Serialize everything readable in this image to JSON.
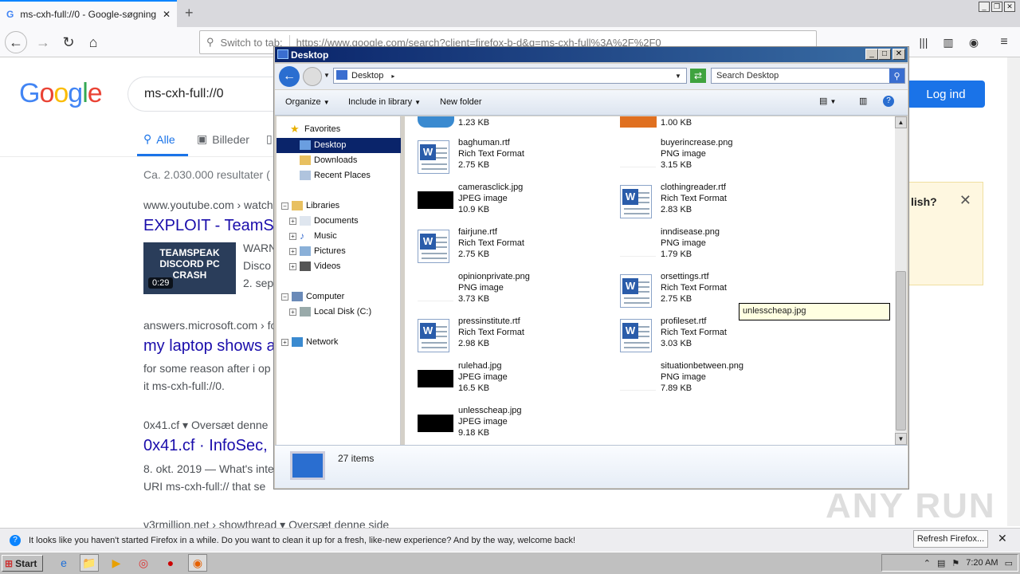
{
  "browser": {
    "tab_title": "ms-cxh-full://0 - Google-søgning",
    "url_placeholder": "Switch to tab:",
    "url": "https://www.google.com/search?client=firefox-b-d&q=ms-cxh-full%3A%2F%2F0"
  },
  "google": {
    "logo": "Google",
    "query": "ms-cxh-full://0",
    "login_label": "Log ind",
    "tabs": [
      {
        "label": "Alle"
      },
      {
        "label": "Billeder"
      }
    ],
    "results_count": "Ca. 2.030.000 resultater (",
    "popup_text": "lish?",
    "results": [
      {
        "cite": "www.youtube.com › watch",
        "title": "EXPLOIT - TeamS",
        "snippet1": "WARN",
        "snippet2": "Disco",
        "date": "2. sep",
        "thumb_text": "TEAMSPEAK DISCORD PC CRASH",
        "duration": "0:29"
      },
      {
        "cite": "answers.microsoft.com › fo",
        "title": "my laptop shows a",
        "snippet1": "for some reason after i op",
        "snippet2": "it ms-cxh-full://0."
      },
      {
        "cite": "0x41.cf ▾ Oversæt denne",
        "title": "0x41.cf · InfoSec, ",
        "snippet1": "8. okt. 2019 — What's inte",
        "snippet2": "URI ms-cxh-full:// that se"
      },
      {
        "cite": "v3rmillion.net › showthread ▾ Oversæt denne side"
      }
    ]
  },
  "notification": {
    "text": "It looks like you haven't started Firefox in a while. Do you want to clean it up for a fresh, like-new experience? And by the way, welcome back!",
    "button": "Refresh Firefox..."
  },
  "watermark": "ANY RUN",
  "explorer": {
    "title": "Desktop",
    "address": "Desktop",
    "search_placeholder": "Search Desktop",
    "toolbar": {
      "organize": "Organize",
      "include": "Include in library",
      "new_folder": "New folder"
    },
    "nav": {
      "favorites": "Favorites",
      "desktop": "Desktop",
      "downloads": "Downloads",
      "recent": "Recent Places",
      "libraries": "Libraries",
      "documents": "Documents",
      "music": "Music",
      "pictures": "Pictures",
      "videos": "Videos",
      "computer": "Computer",
      "local_disk": "Local Disk (C:)",
      "network": "Network"
    },
    "top_sizes": [
      "1.23 KB",
      "1.00 KB"
    ],
    "files": [
      {
        "name": "baghuman.rtf",
        "type": "Rich Text Format",
        "size": "2.75 KB",
        "icon": "word"
      },
      {
        "name": "buyerincrease.png",
        "type": "PNG image",
        "size": "3.15 KB",
        "icon": "png"
      },
      {
        "name": "camerasclick.jpg",
        "type": "JPEG image",
        "size": "10.9 KB",
        "icon": "jpg"
      },
      {
        "name": "clothingreader.rtf",
        "type": "Rich Text Format",
        "size": "2.83 KB",
        "icon": "word"
      },
      {
        "name": "fairjune.rtf",
        "type": "Rich Text Format",
        "size": "2.75 KB",
        "icon": "word"
      },
      {
        "name": "inndisease.png",
        "type": "PNG image",
        "size": "1.79 KB",
        "icon": "png"
      },
      {
        "name": "opinionprivate.png",
        "type": "PNG image",
        "size": "3.73 KB",
        "icon": "png"
      },
      {
        "name": "orsettings.rtf",
        "type": "Rich Text Format",
        "size": "2.75 KB",
        "icon": "word"
      },
      {
        "name": "pressinstitute.rtf",
        "type": "Rich Text Format",
        "size": "2.98 KB",
        "icon": "word"
      },
      {
        "name": "profileset.rtf",
        "type": "Rich Text Format",
        "size": "3.03 KB",
        "icon": "word"
      },
      {
        "name": "rulehad.jpg",
        "type": "JPEG image",
        "size": "16.5 KB",
        "icon": "jpg"
      },
      {
        "name": "situationbetween.png",
        "type": "PNG image",
        "size": "7.89 KB",
        "icon": "png"
      },
      {
        "name": "unlesscheap.jpg",
        "type": "JPEG image",
        "size": "9.18 KB",
        "icon": "jpg"
      }
    ],
    "tooltip": "unlesscheap.jpg",
    "item_count": "27 items"
  },
  "taskbar": {
    "start": "Start",
    "time": "7:20 AM"
  }
}
